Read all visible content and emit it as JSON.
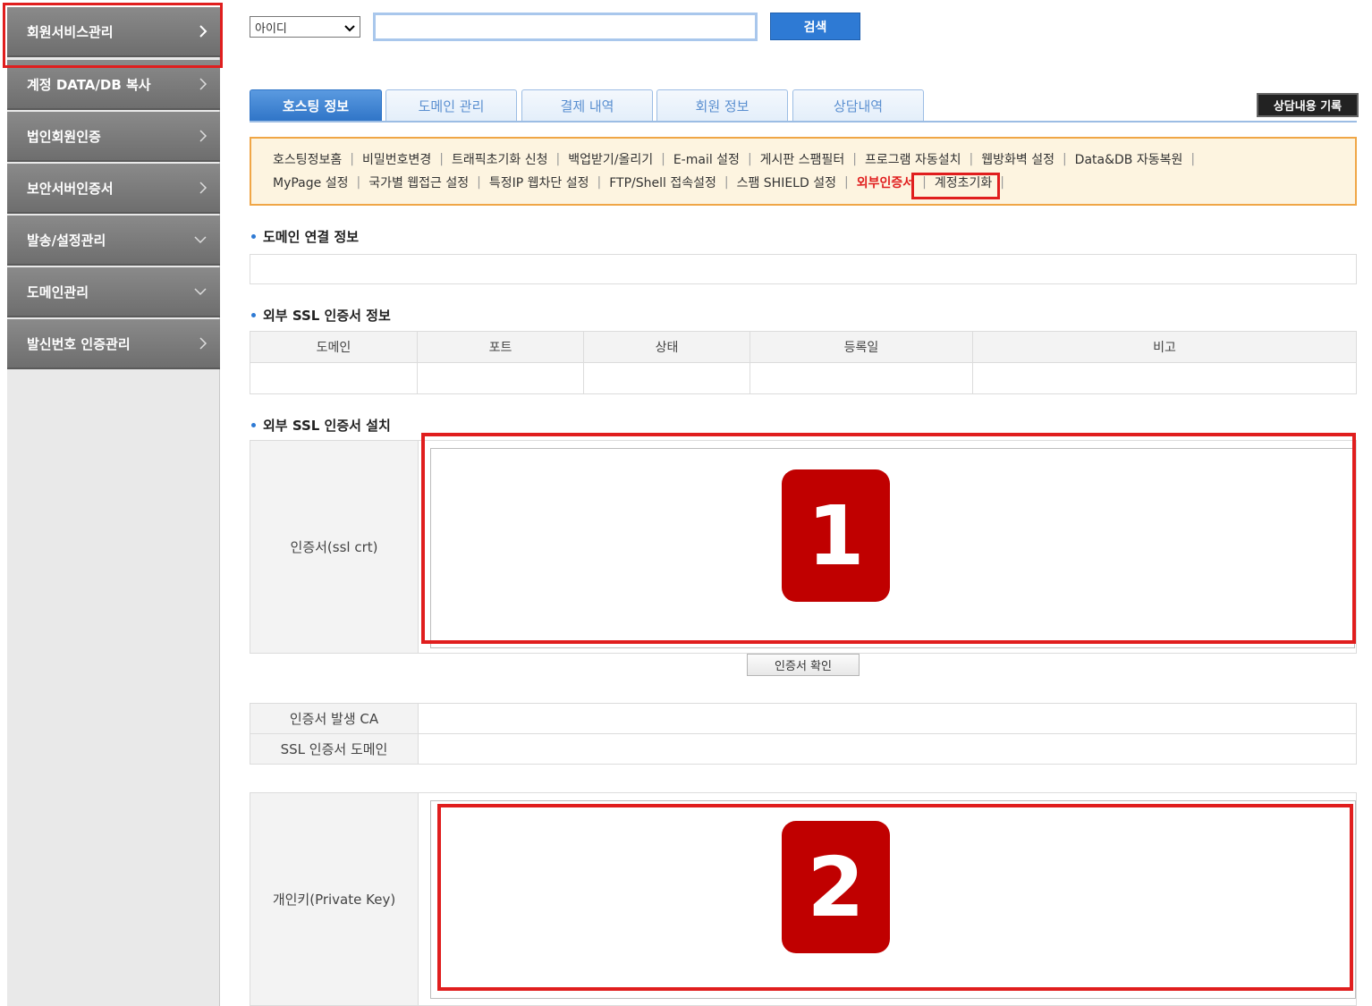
{
  "sidebar": {
    "items": [
      {
        "label": "회원서비스관리",
        "chevron": "right"
      },
      {
        "label": "계정 DATA/DB 복사",
        "chevron": "right"
      },
      {
        "label": "법인회원인증",
        "chevron": "right"
      },
      {
        "label": "보안서버인증서",
        "chevron": "right"
      },
      {
        "label": "발송/설정관리",
        "chevron": "down"
      },
      {
        "label": "도메인관리",
        "chevron": "down"
      },
      {
        "label": "발신번호 인증관리",
        "chevron": "right"
      }
    ],
    "active_color": "#e01e1e"
  },
  "search": {
    "select_value": "아이디",
    "input_value": "",
    "button_label": "검색"
  },
  "tabs": {
    "items": [
      {
        "label": "호스팅 정보",
        "active": true
      },
      {
        "label": "도메인 관리",
        "active": false
      },
      {
        "label": "결제 내역",
        "active": false
      },
      {
        "label": "회원 정보",
        "active": false
      },
      {
        "label": "상담내역",
        "active": false
      }
    ],
    "consult_button": "상담내용 기록"
  },
  "submenu": {
    "row1": [
      "호스팅정보홈",
      "비밀번호변경",
      "트래픽초기화 신청",
      "백업받기/올리기",
      "E-mail 설정",
      "게시판 스팸필터",
      "프로그램 자동설치",
      "웹방화벽 설정",
      "Data&DB 자동복원"
    ],
    "row2": [
      "MyPage 설정",
      "국가별 웹접근 설정",
      "특정IP 웹차단 설정",
      "FTP/Shell 접속설정",
      "스팸 SHIELD 설정",
      "외부인증서",
      "계정초기화"
    ],
    "separator": "|",
    "highlighted": "외부인증서"
  },
  "sections": {
    "domain_link": "도메인 연결 정보",
    "ssl_info": "외부 SSL 인증서 정보",
    "ssl_install": "외부 SSL 인증서 설치"
  },
  "ssl_table": {
    "headers": [
      "도메인",
      "포트",
      "상태",
      "등록일",
      "비고"
    ]
  },
  "install": {
    "cert_label": "인증서(ssl crt)",
    "cert_value": "",
    "confirm_button": "인증서 확인",
    "ca_label": "인증서 발생 CA",
    "ca_value": "",
    "domain_label": "SSL 인증서 도메인",
    "domain_value": "",
    "key_label": "개인키(Private Key)",
    "key_value": "",
    "badge1": "1",
    "badge2": "2"
  },
  "colors": {
    "accent_blue": "#2e7ad4",
    "highlight_red": "#e01e1e",
    "badge_red": "#c00000",
    "submenu_bg": "#fdf4e0",
    "submenu_border": "#f0a646"
  }
}
